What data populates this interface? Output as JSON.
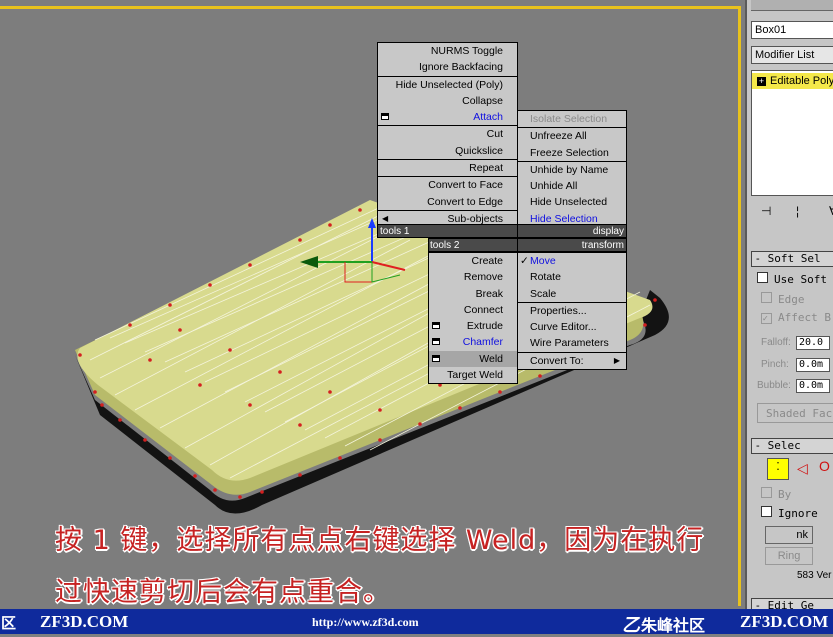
{
  "right_panel": {
    "object_name": "Box01",
    "modifier_list": "Modifier List",
    "stack_item": "Editable Poly",
    "soft_selection": {
      "title": "Soft Sel",
      "use_soft": "Use Soft",
      "edge": "Edge",
      "affect": "Affect B",
      "falloff_label": "Falloff:",
      "falloff_value": "20.0",
      "pinch_label": "Pinch:",
      "pinch_value": "0.0m",
      "bubble_label": "Bubble:",
      "bubble_value": "0.0m",
      "shaded_face": "Shaded Fac"
    },
    "selection": {
      "title": "Selec",
      "by": "By",
      "ignore": "Ignore",
      "shrink": "nk",
      "ring": "Ring",
      "count": "583 Ver"
    },
    "edit_geometry": "Edit Ge"
  },
  "quad_menu": {
    "left_top": [
      "NURMS Toggle",
      "Ignore Backfacing",
      "Hide Unselected (Poly)",
      "Collapse",
      "Attach",
      "Cut",
      "Quickslice",
      "Repeat",
      "Convert to Face",
      "Convert to Edge",
      "Sub-objects"
    ],
    "right_top": [
      "Isolate Selection",
      "Unfreeze All",
      "Freeze Selection",
      "Unhide by Name",
      "Unhide All",
      "Hide Unselected",
      "Hide Selection"
    ],
    "header_tools1": "tools 1",
    "header_display": "display",
    "header_tools2": "tools 2",
    "header_transform": "transform",
    "left_bottom": [
      "Create",
      "Remove",
      "Break",
      "Connect",
      "Extrude",
      "Chamfer",
      "Weld",
      "Target Weld"
    ],
    "right_bottom": [
      "Move",
      "Rotate",
      "Scale",
      "Properties...",
      "Curve Editor...",
      "Wire Parameters",
      "Convert To:"
    ]
  },
  "caption": {
    "line1": "按 1 键，选择所有点点右键选择 Weld，因为在执行",
    "line2": "过快速剪切后会有点重合。"
  },
  "footer": {
    "left_edge": "区",
    "left_site": "ZF3D.COM",
    "url": "http://www.zf3d.com",
    "brand": "朱峰社区",
    "right_site": "ZF3D.COM"
  },
  "colors": {
    "accent_yellow": "#e8c21c",
    "menu_blue": "#1010e0",
    "caption_red": "#c62222",
    "footer_blue": "#0f2a9c"
  }
}
